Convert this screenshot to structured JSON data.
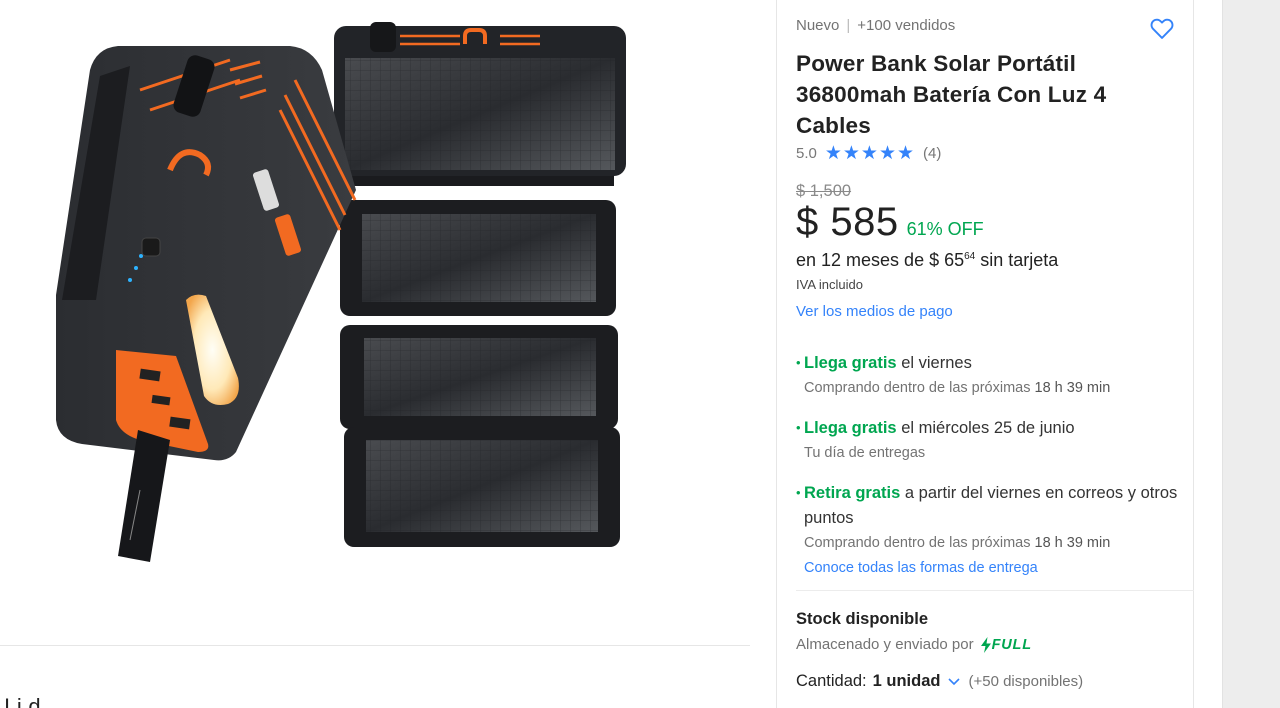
{
  "product": {
    "condition": "Nuevo",
    "sold": "+100 vendidos",
    "title": "Power Bank Solar Portátil 36800mah Batería Con Luz 4 Cables",
    "rating_value": "5.0",
    "stars": "★★★★★",
    "review_count": "(4)",
    "old_price": "$ 1,500",
    "price": "$ 585",
    "discount": "61% OFF",
    "installments_pre": "en 12 meses de $ 65",
    "installments_cents": "64",
    "installments_post": " sin tarjeta",
    "tax_note": "IVA incluido",
    "payment_link": "Ver los medios de pago"
  },
  "shipping": [
    {
      "highlight": "Llega gratis",
      "rest": " el viernes",
      "note": "Comprando dentro de las próximas ",
      "note_time": "18 h 39 min"
    },
    {
      "highlight": "Llega gratis",
      "rest": " el miércoles 25 de junio",
      "note": "Tu día de entregas"
    },
    {
      "highlight": "Retira gratis",
      "rest": " a partir del viernes en correos y otros puntos",
      "note": "Comprando dentro de las próximas ",
      "note_time": "18 h 39 min",
      "link": "Conoce todas las formas de entrega"
    }
  ],
  "stock": {
    "title": "Stock disponible",
    "stored_by": "Almacenado y enviado por",
    "badge": "FULL",
    "qty_label": "Cantidad:",
    "qty_value": "1 unidad",
    "qty_available": "(+50 disponibles)"
  },
  "description_partial": "I    i    d",
  "colors": {
    "accent_blue": "#3483fa",
    "green": "#00a650",
    "product_orange": "#f26a21"
  },
  "icons": [
    "heart-icon",
    "star-icon",
    "bolt-icon",
    "chevron-down-icon"
  ]
}
